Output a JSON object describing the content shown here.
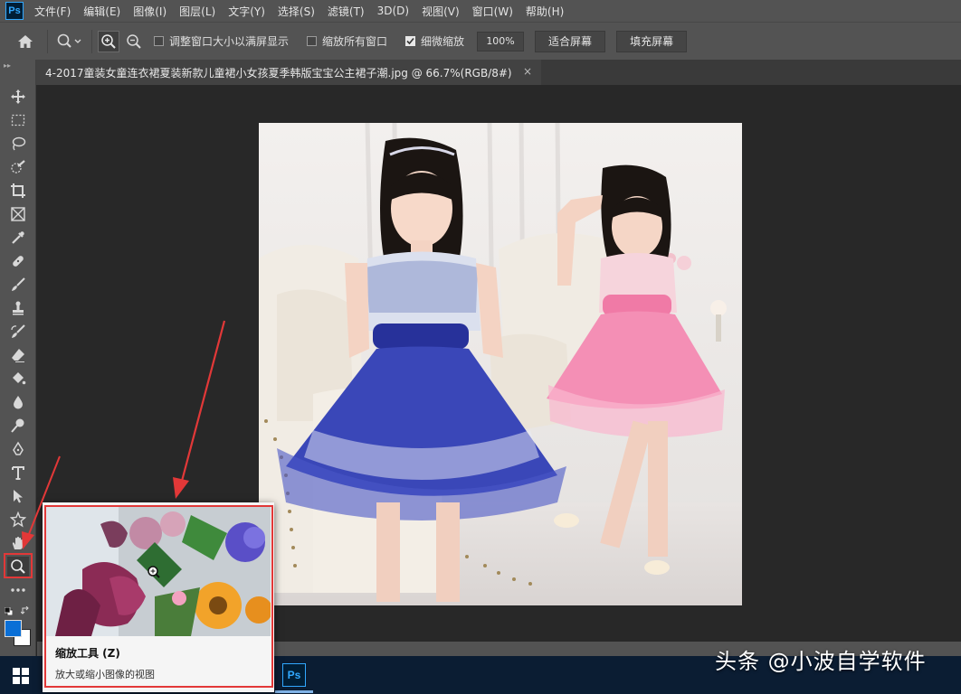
{
  "app": {
    "logo": "Ps"
  },
  "menu": [
    "文件(F)",
    "编辑(E)",
    "图像(I)",
    "图层(L)",
    "文字(Y)",
    "选择(S)",
    "滤镜(T)",
    "3D(D)",
    "视图(V)",
    "窗口(W)",
    "帮助(H)"
  ],
  "options": {
    "resize_windows_label": "调整窗口大小以满屏显示",
    "zoom_all_windows_label": "缩放所有窗口",
    "scrubby_zoom_label": "细微缩放",
    "zoom_value": "100%",
    "fit_screen_label": "适合屏幕",
    "fill_screen_label": "填充屏幕"
  },
  "document_tab": {
    "title": "4-2017童装女童连衣裙夏装新款儿童裙小女孩夏季韩版宝宝公主裙子潮.jpg @ 66.7%(RGB/8#)",
    "close": "×"
  },
  "tools": [
    "move-icon",
    "marquee-icon",
    "lasso-icon",
    "quick-select-icon",
    "crop-icon",
    "frame-icon",
    "eyedropper-icon",
    "healing-brush-icon",
    "brush-icon",
    "clone-stamp-icon",
    "history-brush-icon",
    "eraser-icon",
    "paint-bucket-icon",
    "blur-icon",
    "dodge-icon",
    "pen-icon",
    "type-icon",
    "path-select-icon",
    "custom-shape-icon",
    "hand-icon",
    "zoom-icon",
    "more-tools-icon"
  ],
  "tooltip": {
    "title": "缩放工具 (Z)",
    "description": "放大或缩小图像的视图"
  },
  "taskbar": {
    "ps_label": "Ps"
  },
  "watermark": "头条 @小波自学软件",
  "colors": {
    "foreground": "#0a6fd6",
    "background": "#ffffff",
    "highlight_red": "#e23838",
    "ps_blue": "#31a8ff"
  }
}
